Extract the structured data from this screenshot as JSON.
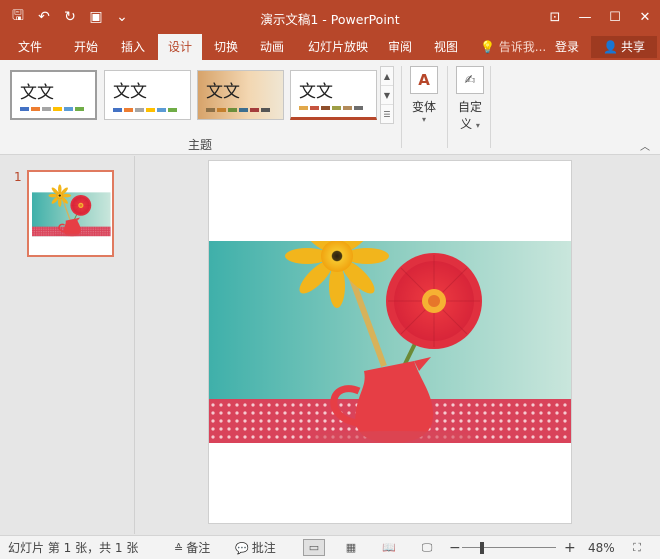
{
  "window": {
    "title": "演示文稿1 - PowerPoint",
    "qat": [
      {
        "name": "save-icon",
        "glyph": "🖫"
      },
      {
        "name": "undo-icon",
        "glyph": "↶"
      },
      {
        "name": "redo-icon",
        "glyph": "↻"
      },
      {
        "name": "present-icon",
        "glyph": "▣"
      },
      {
        "name": "customize-qat-icon",
        "glyph": "⌄"
      }
    ],
    "controls": [
      {
        "name": "ribbon-display-icon",
        "glyph": "⊡"
      },
      {
        "name": "minimize-icon",
        "glyph": "—"
      },
      {
        "name": "maximize-icon",
        "glyph": "☐"
      },
      {
        "name": "close-icon",
        "glyph": "✕"
      }
    ],
    "accent": "#b7472a"
  },
  "tabs": [
    {
      "label": "文件",
      "active": false
    },
    {
      "label": "开始",
      "active": false
    },
    {
      "label": "插入",
      "active": false
    },
    {
      "label": "设计",
      "active": true
    },
    {
      "label": "切换",
      "active": false
    },
    {
      "label": "动画",
      "active": false
    },
    {
      "label": "幻灯片放映",
      "active": false
    },
    {
      "label": "审阅",
      "active": false
    },
    {
      "label": "视图",
      "active": false
    }
  ],
  "tellme": {
    "icon": "lightbulb-icon",
    "label": "告诉我..."
  },
  "login_label": "登录",
  "share_label": "共享",
  "ribbon": {
    "themes": [
      {
        "sample": "文文",
        "style": "office",
        "selected": true,
        "colors": [
          "#4472c4",
          "#ed7d31",
          "#a5a5a5",
          "#ffc000",
          "#5b9bd5",
          "#70ad47"
        ]
      },
      {
        "sample": "文文",
        "style": "office-2",
        "selected": false,
        "colors": [
          "#4472c4",
          "#ed7d31",
          "#a5a5a5",
          "#ffc000",
          "#5b9bd5",
          "#70ad47"
        ]
      },
      {
        "sample": "文文",
        "style": "image",
        "selected": false,
        "colors": [
          "#8b6f47",
          "#c47f2d",
          "#6b8e3a",
          "#3c6e8f",
          "#a33c3c",
          "#555555"
        ]
      },
      {
        "sample": "文文",
        "style": "plain",
        "selected": false,
        "colors": [
          "#e1a84b",
          "#c6543f",
          "#8f4f2c",
          "#9e9e46",
          "#b38b5a",
          "#6d6d6d"
        ]
      }
    ],
    "themes_group_label": "主题",
    "variants_label": "变体",
    "customize_label_1": "自定",
    "customize_label_2": "义"
  },
  "slides_pane": {
    "slide_number": "1"
  },
  "status": {
    "slide_info": "幻灯片 第 1 张，共 1 张",
    "notes_label": "备注",
    "comments_label": "批注",
    "zoom_minus": "−",
    "zoom_plus": "+",
    "zoom_level": "48%",
    "zoom_fraction": 0.48
  }
}
